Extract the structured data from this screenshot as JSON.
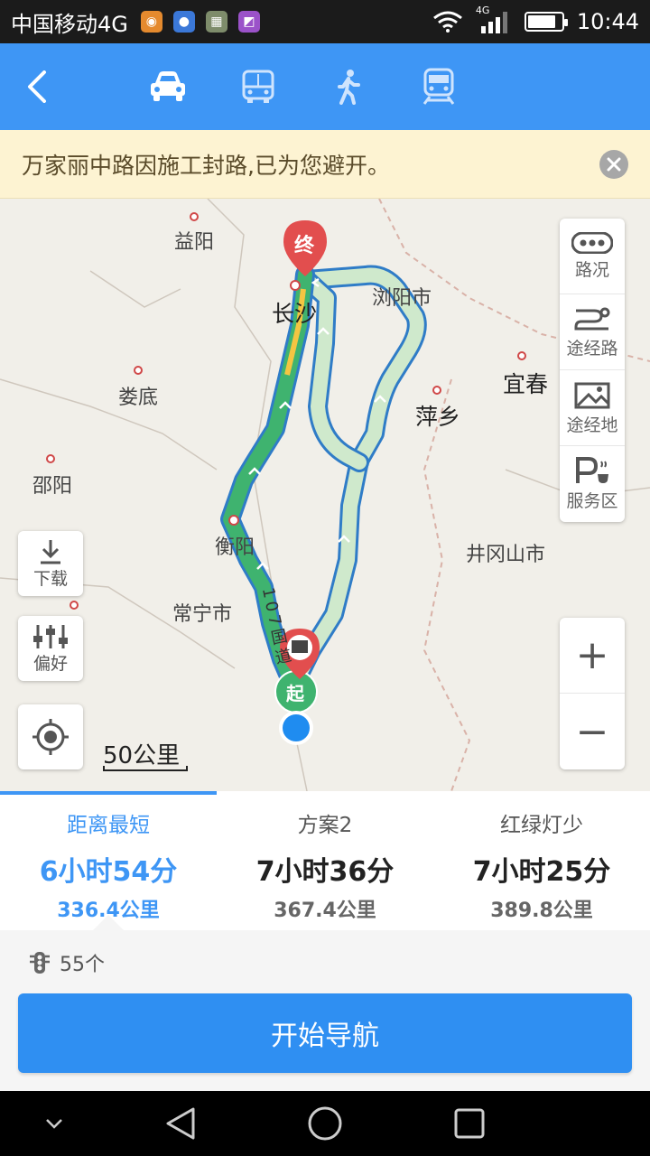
{
  "status_bar": {
    "carrier": "中国移动4G",
    "network": "4G",
    "time": "10:44"
  },
  "header": {
    "modes": [
      "car-icon",
      "bus-icon",
      "walk-icon",
      "train-icon"
    ],
    "selected_mode": "car"
  },
  "notice": {
    "text": "万家丽中路因施工封路,已为您避开。"
  },
  "map": {
    "cities": [
      "益阳",
      "长沙",
      "浏阳市",
      "娄底",
      "宜春",
      "萍乡",
      "邵阳",
      "衡阳",
      "井冈山市",
      "常宁市"
    ],
    "road_label": "107国道",
    "start_label": "起",
    "end_label": "终",
    "side_panel": {
      "traffic": "路况",
      "via_route": "途经路",
      "via_place": "途经地",
      "service": "服务区"
    },
    "download": "下载",
    "preference": "偏好",
    "scale": "50公里"
  },
  "plans": [
    {
      "name": "距离最短",
      "time": "6小时54分",
      "distance": "336.4公里"
    },
    {
      "name": "方案2",
      "time": "7小时36分",
      "distance": "367.4公里"
    },
    {
      "name": "红绿灯少",
      "time": "7小时25分",
      "distance": "389.8公里"
    }
  ],
  "traffic_lights": "55个",
  "start_nav": "开始导航",
  "colors": {
    "primary": "#3e96f5",
    "route_main": "#3fb36f",
    "route_alt": "#cfe9cc",
    "notice_bg": "#fdf3d2"
  }
}
